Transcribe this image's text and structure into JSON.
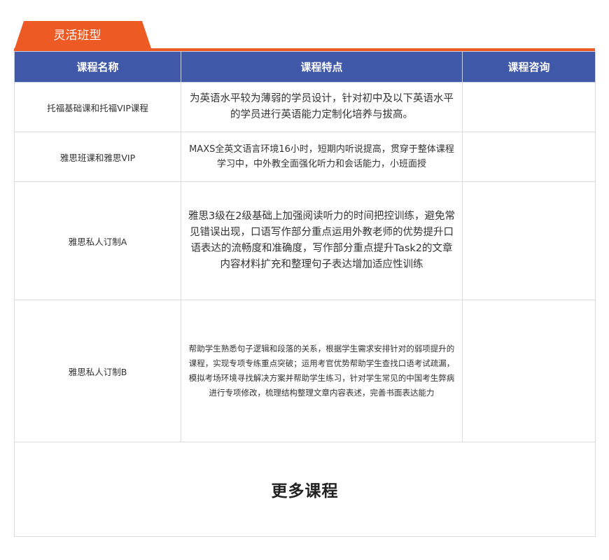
{
  "tab": {
    "label": "灵活班型",
    "color": "#ee5a24"
  },
  "table": {
    "header_color": "#3f58a8",
    "columns": [
      "课程名称",
      "课程特点",
      "课程咨询"
    ],
    "rows": [
      {
        "name": "托福基础课和托福VIP课程",
        "features": "为英语水平较为薄弱的学员设计，针对初中及以下英语水平的学员进行英语能力定制化培养与拔高。",
        "consult": ""
      },
      {
        "name": "雅思班课和雅思VIP",
        "features": "MAXS全英文语言环境16小时，短期内听说提高，贯穿于整体课程学习中，中外教全面强化听力和会话能力，小班面授",
        "consult": ""
      },
      {
        "name": "雅思私人订制A",
        "features": "雅思3级在2级基础上加强阅读听力的时间把控训练，避免常见错误出现，口语写作部分重点运用外教老师的优势提升口语表达的流畅度和准确度，写作部分重点提升Task2的文章内容材料扩充和整理句子表达增加适应性训练",
        "consult": ""
      },
      {
        "name": "雅思私人订制B",
        "features": "帮助学生熟悉句子逻辑和段落的关系，根据学生需求安排针对的弱项提升的课程，实现专项专练重点突破；运用考官优势帮助学生查找口语考试疏漏，模拟考场环境寻找解决方案并帮助学生练习，针对学生常见的中国考生弊病进行专项修改，梳理结构整理文章内容表述，完善书面表达能力",
        "consult": ""
      }
    ]
  },
  "more": {
    "label": "更多课程"
  }
}
